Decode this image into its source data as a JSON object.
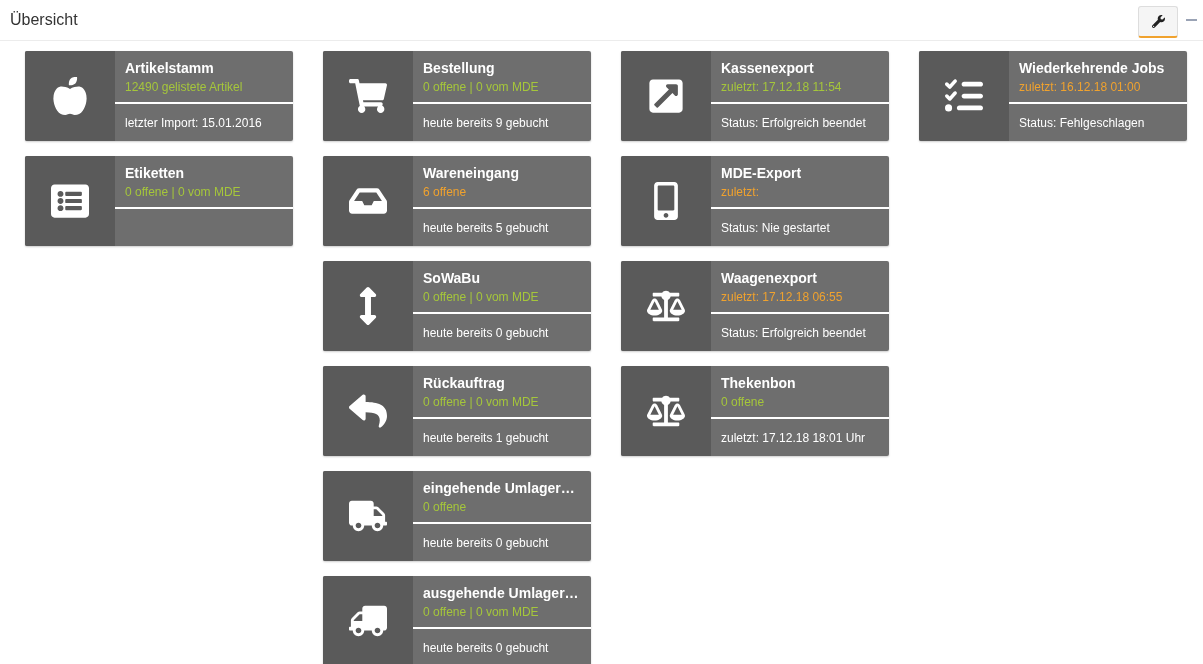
{
  "header": {
    "title": "Übersicht"
  },
  "columns": [
    {
      "cards": [
        {
          "title": "Artikelstamm",
          "subtitle": "12490 gelistete Artikel",
          "color": "#a5c63b",
          "footer": "letzter Import: 15.01.2016"
        },
        {
          "title": "Etiketten",
          "subtitle": "0 offene | 0 vom MDE",
          "color": "#a5c63b"
        }
      ]
    },
    {
      "cards": [
        {
          "title": "Bestellung",
          "subtitle": "0 offene | 0 vom MDE",
          "color": "#a5c63b",
          "footer": "heute bereits 9 gebucht"
        },
        {
          "title": "Wareneingang",
          "subtitle": "6 offene",
          "color": "#f0a22e",
          "footer": "heute bereits 5 gebucht"
        },
        {
          "title": "SoWaBu",
          "subtitle": "0 offene | 0 vom MDE",
          "color": "#a5c63b",
          "footer": "heute bereits 0 gebucht"
        },
        {
          "title": "Rückauftrag",
          "subtitle": "0 offene | 0 vom MDE",
          "color": "#a5c63b",
          "footer": "heute bereits 1 gebucht"
        },
        {
          "title": "eingehende Umlager…",
          "subtitle": "0 offene",
          "color": "#a5c63b",
          "footer": "heute bereits 0 gebucht"
        },
        {
          "title": "ausgehende Umlager…",
          "subtitle": "0 offene | 0 vom MDE",
          "color": "#a5c63b",
          "footer": "heute bereits 0 gebucht"
        }
      ]
    },
    {
      "cards": [
        {
          "title": "Kassenexport",
          "subtitle": "zuletzt: 17.12.18 11:54",
          "color": "#a5c63b",
          "footer": "Status: Erfolgreich beendet"
        },
        {
          "title": "MDE-Export",
          "subtitle": "zuletzt:",
          "color": "#f0a22e",
          "footer": "Status: Nie gestartet"
        },
        {
          "title": "Waagenexport",
          "subtitle": "zuletzt: 17.12.18 06:55",
          "color": "#f0a22e",
          "footer": "Status: Erfolgreich beendet"
        },
        {
          "title": "Thekenbon",
          "subtitle": "0 offene",
          "color": "#a5c63b",
          "footer": "zuletzt: 17.12.18 18:01 Uhr"
        }
      ]
    },
    {
      "cards": [
        {
          "title": "Wiederkehrende Jobs",
          "subtitle": "zuletzt: 16.12.18 01:00",
          "color": "#f0a22e",
          "footer": "Status: Fehlgeschlagen"
        }
      ]
    }
  ]
}
